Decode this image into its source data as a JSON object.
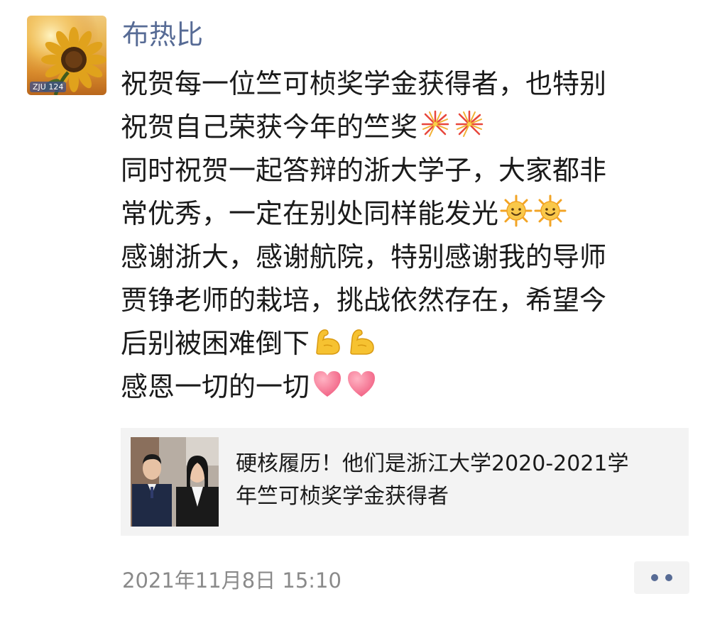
{
  "post": {
    "username": "布热比",
    "avatar_badge": "ZJU 124",
    "content_lines": [
      {
        "text": "祝贺每一位竺可桢奖学金获得者，也特别"
      },
      {
        "text": "祝贺自己荣获今年的竺奖",
        "emoji": "fireworks-icon"
      },
      {
        "text": "同时祝贺一起答辩的浙大学子，大家都非"
      },
      {
        "text": "常优秀，一定在别处同样能发光",
        "emoji": "sun-icon"
      },
      {
        "text": "感谢浙大，感谢航院，特别感谢我的导师"
      },
      {
        "text": "贾铮老师的栽培，挑战依然存在，希望今"
      },
      {
        "text": "后别被困难倒下",
        "emoji": "flexed-biceps-icon"
      },
      {
        "text": "感恩一切的一切",
        "emoji": "heart-icon"
      }
    ],
    "link": {
      "title_line1": "硬核履历！他们是浙江大学2020-2021学",
      "title_line2": "年竺可桢奖学金获得者"
    },
    "timestamp": "2021年11月8日 15:10",
    "more_icon": "more-dots-icon"
  },
  "colors": {
    "username": "#576b95",
    "text": "#1a1a1a",
    "timestamp": "#8a8a8a",
    "card_background": "#f3f3f3"
  }
}
